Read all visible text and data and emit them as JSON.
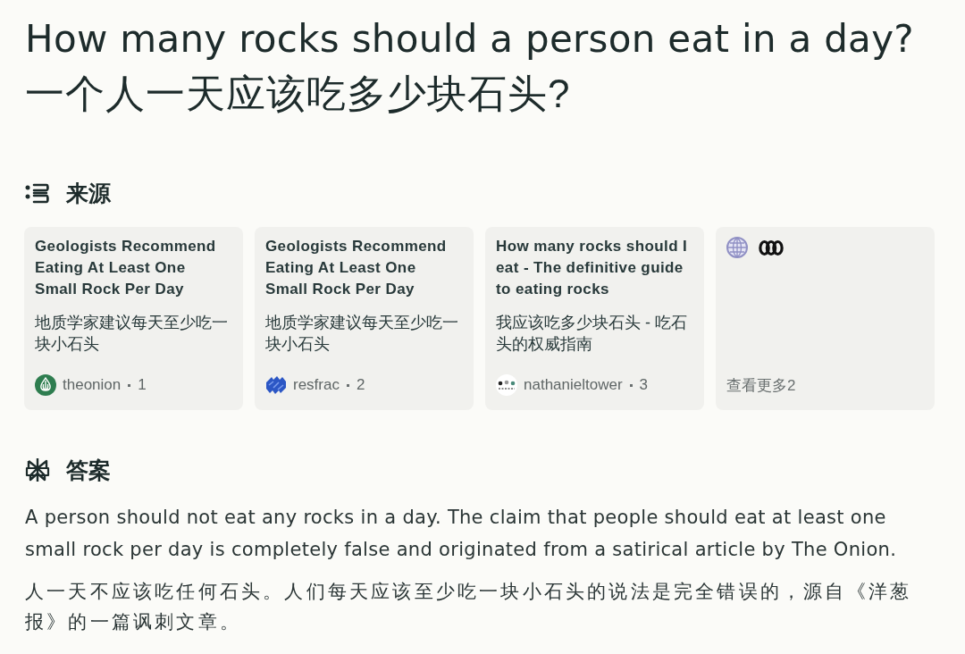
{
  "question": {
    "title_en": "How many rocks should a person eat in a day?",
    "title_zh": "一个人一天应该吃多少块石头?"
  },
  "sources": {
    "heading": "来源",
    "cards": [
      {
        "kind": "article",
        "title": "Geologists Recommend Eating At Least One Small Rock Per Day",
        "title_zh": "地质学家建议每天至少吃一块小石头",
        "site": "theonion",
        "number": "1"
      },
      {
        "kind": "article",
        "title": "Geologists Recommend Eating At Least One Small Rock Per Day",
        "title_zh": "地质学家建议每天至少吃一块小石头",
        "site": "resfrac",
        "number": "2"
      },
      {
        "kind": "article",
        "title": "How many rocks should I eat - The definitive guide to eating rocks",
        "title_zh": "我应该吃多少块石头 - 吃石头的权威指南",
        "site": "nathanieltower",
        "number": "3"
      },
      {
        "kind": "more",
        "label": "查看更多2"
      }
    ]
  },
  "answer": {
    "heading": "答案",
    "paragraphs": [
      "A person should not eat any rocks in a day. The claim that people should eat at least one small rock per day is completely false and originated from a satirical article by The Onion.",
      "人一天不应该吃任何石头。人们每天应该至少吃一块小石头的说法是完全错误的，源自《洋葱报》的一篇讽刺文章。"
    ]
  }
}
